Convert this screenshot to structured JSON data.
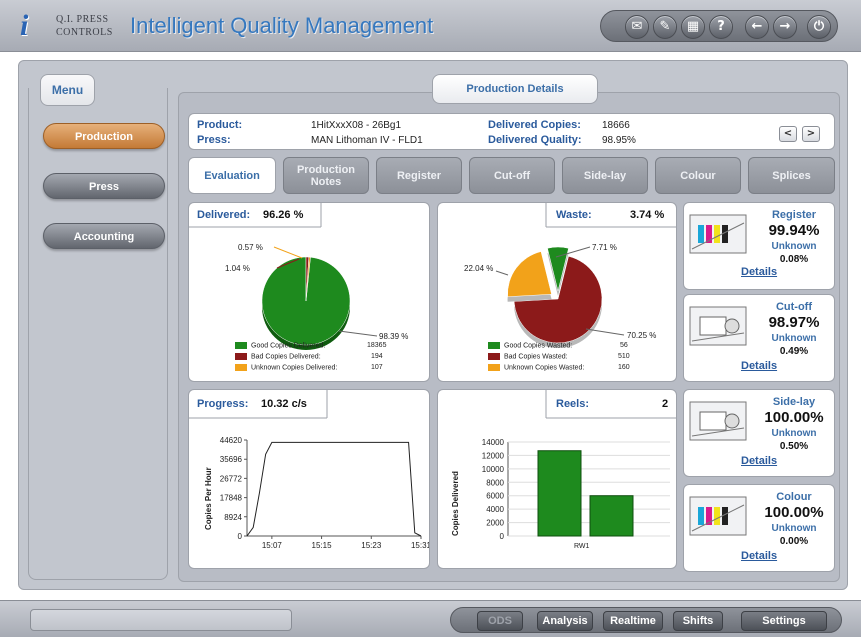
{
  "header": {
    "logo_line1": "Q.I. PRESS",
    "logo_line2": "CONTROLS",
    "title": "Intelligent Quality Management",
    "toolbar_icons": [
      "mail-icon",
      "tools-icon",
      "calculator-icon",
      "help-icon",
      "back-icon",
      "forward-icon",
      "power-icon"
    ]
  },
  "menu": {
    "title": "Menu",
    "items": [
      {
        "label": "Production",
        "active": true
      },
      {
        "label": "Press",
        "active": false
      },
      {
        "label": "Accounting",
        "active": false
      }
    ]
  },
  "production_details": {
    "title": "Production Details",
    "product_label": "Product:",
    "product_value": "1HitXxxX08 - 26Bg1",
    "press_label": "Press:",
    "press_value": "MAN Lithoman IV - FLD1",
    "delivered_copies_label": "Delivered Copies:",
    "delivered_copies_value": "18666",
    "delivered_quality_label": "Delivered Quality:",
    "delivered_quality_value": "98.95%",
    "nav_prev": "<",
    "nav_next": ">"
  },
  "tabs": [
    {
      "label": "Evaluation",
      "active": true
    },
    {
      "label": "Production Notes",
      "active": false
    },
    {
      "label": "Register",
      "active": false
    },
    {
      "label": "Cut-off",
      "active": false
    },
    {
      "label": "Side-lay",
      "active": false
    },
    {
      "label": "Colour",
      "active": false
    },
    {
      "label": "Splices",
      "active": false
    }
  ],
  "delivered_panel": {
    "label": "Delivered:",
    "value": "96.26 %",
    "pct_labels": [
      "0.57 %",
      "1.04 %",
      "98.39 %"
    ],
    "legend": [
      {
        "label": "Good Copies Delivered:",
        "value": "18365",
        "color": "#1e8a1e"
      },
      {
        "label": "Bad Copies Delivered:",
        "value": "194",
        "color": "#8c1a1a"
      },
      {
        "label": "Unknown Copies Delivered:",
        "value": "107",
        "color": "#f2a21a"
      }
    ]
  },
  "waste_panel": {
    "label": "Waste:",
    "value": "3.74 %",
    "pct_labels": [
      "7.71 %",
      "22.04 %",
      "70.25 %"
    ],
    "legend": [
      {
        "label": "Good Copies Wasted:",
        "value": "56",
        "color": "#1e8a1e"
      },
      {
        "label": "Bad Copies Wasted:",
        "value": "510",
        "color": "#8c1a1a"
      },
      {
        "label": "Unknown Copies Wasted:",
        "value": "160",
        "color": "#f2a21a"
      }
    ]
  },
  "progress_panel": {
    "label": "Progress:",
    "value": "10.32 c/s",
    "ylabel": "Copies Per Hour",
    "yticks": [
      "44620",
      "35696",
      "26772",
      "17848",
      "8924",
      "0"
    ],
    "xticks": [
      "15:07",
      "15:15",
      "15:23",
      "15:31"
    ]
  },
  "reels_panel": {
    "label": "Reels:",
    "value": "2",
    "ylabel": "Copies Delivered",
    "yticks": [
      "14000",
      "12000",
      "10000",
      "8000",
      "6000",
      "4000",
      "2000",
      "0"
    ],
    "xlabel_cat": "RW1"
  },
  "side_panels": [
    {
      "title": "Register",
      "value": "99.94%",
      "unknown_label": "Unknown",
      "unknown_value": "0.08%",
      "details": "Details"
    },
    {
      "title": "Cut-off",
      "value": "98.97%",
      "unknown_label": "Unknown",
      "unknown_value": "0.49%",
      "details": "Details"
    },
    {
      "title": "Side-lay",
      "value": "100.00%",
      "unknown_label": "Unknown",
      "unknown_value": "0.50%",
      "details": "Details"
    },
    {
      "title": "Colour",
      "value": "100.00%",
      "unknown_label": "Unknown",
      "unknown_value": "0.00%",
      "details": "Details"
    }
  ],
  "bottom": {
    "buttons": [
      {
        "label": "ODS",
        "disabled": true
      },
      {
        "label": "Analysis",
        "disabled": false
      },
      {
        "label": "Realtime",
        "disabled": false
      },
      {
        "label": "Shifts",
        "disabled": false
      },
      {
        "label": "Settings",
        "disabled": false
      }
    ]
  },
  "chart_data": [
    {
      "type": "pie",
      "categories": [
        "Good Copies Delivered",
        "Bad Copies Delivered",
        "Unknown Copies Delivered"
      ],
      "values": [
        98.39,
        1.04,
        0.57
      ],
      "colors": [
        "#1e8a1e",
        "#8c1a1a",
        "#f2a21a"
      ]
    },
    {
      "type": "pie",
      "categories": [
        "Good Copies Wasted",
        "Bad Copies Wasted",
        "Unknown Copies Wasted"
      ],
      "values": [
        7.71,
        70.25,
        22.04
      ],
      "colors": [
        "#1e8a1e",
        "#8c1a1a",
        "#f2a21a"
      ]
    },
    {
      "type": "line",
      "ylabel": "Copies Per Hour",
      "ylim": [
        0,
        44620
      ],
      "x": [
        "15:03",
        "15:04",
        "15:05",
        "15:06",
        "15:07",
        "15:29",
        "15:30",
        "15:31"
      ],
      "values": [
        0,
        4000,
        20000,
        38000,
        43500,
        43500,
        1500,
        0
      ]
    },
    {
      "type": "bar",
      "ylabel": "Copies Delivered",
      "ylim": [
        0,
        14000
      ],
      "categories": [
        "RW1",
        "RW1"
      ],
      "values": [
        12700,
        6000
      ]
    }
  ]
}
